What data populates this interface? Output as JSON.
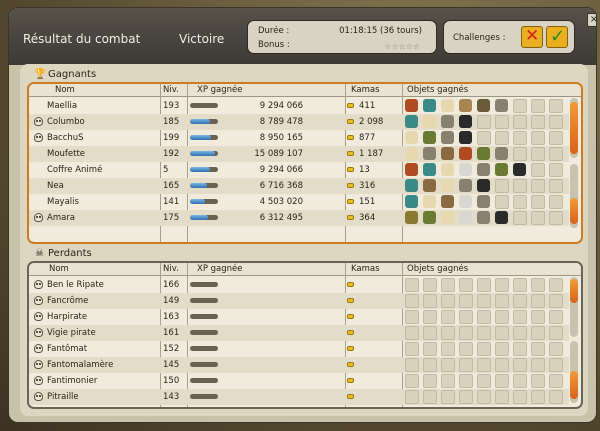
{
  "window": {
    "title": "Résultat du combat",
    "result": "Victoire",
    "duration_label": "Durée :",
    "duration_value": "01:18:15 (36 tours)",
    "bonus_label": "Bonus :",
    "bonus_stars": "☆☆☆☆☆",
    "challenges_label": "Challenges :",
    "close_label": "×"
  },
  "winners": {
    "section_label": "Gagnants",
    "headers": {
      "name": "Nom",
      "level": "Niv.",
      "xp": "XP gagnée",
      "kamas": "Kamas",
      "items": "Objets gagnés"
    },
    "rows": [
      {
        "name": "Maellia",
        "level": "193",
        "xp": "9 294 066",
        "xp_fill": 0,
        "kamas": "411",
        "dead": false,
        "items": [
          "#b04a20",
          "#3a8a88",
          "#e8d8b0",
          "#a88450",
          "#6a5c3a",
          "#8a8070"
        ]
      },
      {
        "name": "Columbo",
        "level": "185",
        "xp": "8 789 478",
        "xp_fill": 0.7,
        "kamas": "2 098",
        "dead": true,
        "items": [
          "#3a8a88",
          "#e8d8b0",
          "#8a8070",
          "#2a2a2a"
        ]
      },
      {
        "name": "BacchuS",
        "level": "199",
        "xp": "8 950 165",
        "xp_fill": 0.75,
        "kamas": "877",
        "dead": true,
        "items": [
          "#e8d8b0",
          "#6a7a30",
          "#8a8070",
          "#2a2a2a"
        ]
      },
      {
        "name": "Moufette",
        "level": "192",
        "xp": "15 089 107",
        "xp_fill": 0.9,
        "kamas": "1 187",
        "dead": false,
        "items": [
          "#e8d8b0",
          "#8a8070",
          "#8a6a40",
          "#b04a20",
          "#6a7a30",
          "#8a8070"
        ]
      },
      {
        "name": "Coffre Animé",
        "level": "5",
        "xp": "9 294 066",
        "xp_fill": 0.7,
        "kamas": "13",
        "dead": false,
        "items": [
          "#b04a20",
          "#3a8a88",
          "#e8d8b0",
          "#d8d8d0",
          "#8a8070",
          "#6a7a30",
          "#2a2a2a"
        ]
      },
      {
        "name": "Nea",
        "level": "165",
        "xp": "6 716 368",
        "xp_fill": 0.6,
        "kamas": "316",
        "dead": false,
        "items": [
          "#3a8a88",
          "#8a6a40",
          "#e8d8b0",
          "#8a8070",
          "#2a2a2a"
        ]
      },
      {
        "name": "Mayalis",
        "level": "141",
        "xp": "4 503 020",
        "xp_fill": 0.55,
        "kamas": "151",
        "dead": false,
        "items": [
          "#3a8a88",
          "#e8d8b0",
          "#8a6a40",
          "#d8d8d0",
          "#8a8070"
        ]
      },
      {
        "name": "Amara",
        "level": "175",
        "xp": "6 312 495",
        "xp_fill": 0.65,
        "kamas": "364",
        "dead": true,
        "items": [
          "#8a7a30",
          "#6a7a30",
          "#e8d8b0",
          "#d8d8d0",
          "#8a8070",
          "#2a2a2a"
        ]
      }
    ]
  },
  "losers": {
    "section_label": "Perdants",
    "headers": {
      "name": "Nom",
      "level": "Niv.",
      "xp": "XP gagnée",
      "kamas": "Kamas",
      "items": "Objets gagnés"
    },
    "rows": [
      {
        "name": "Ben le Ripate",
        "level": "166"
      },
      {
        "name": "Fancrôme",
        "level": "149"
      },
      {
        "name": "Harpirate",
        "level": "163"
      },
      {
        "name": "Vigie pirate",
        "level": "161"
      },
      {
        "name": "Fantômat",
        "level": "152"
      },
      {
        "name": "Fantomalamère",
        "level": "145"
      },
      {
        "name": "Fantimonier",
        "level": "150"
      },
      {
        "name": "Pitraille",
        "level": "143"
      }
    ]
  },
  "colors": {
    "accent": "#d07a20",
    "xp_bar": "#2f6fb0",
    "kamas": "#e8c020"
  }
}
